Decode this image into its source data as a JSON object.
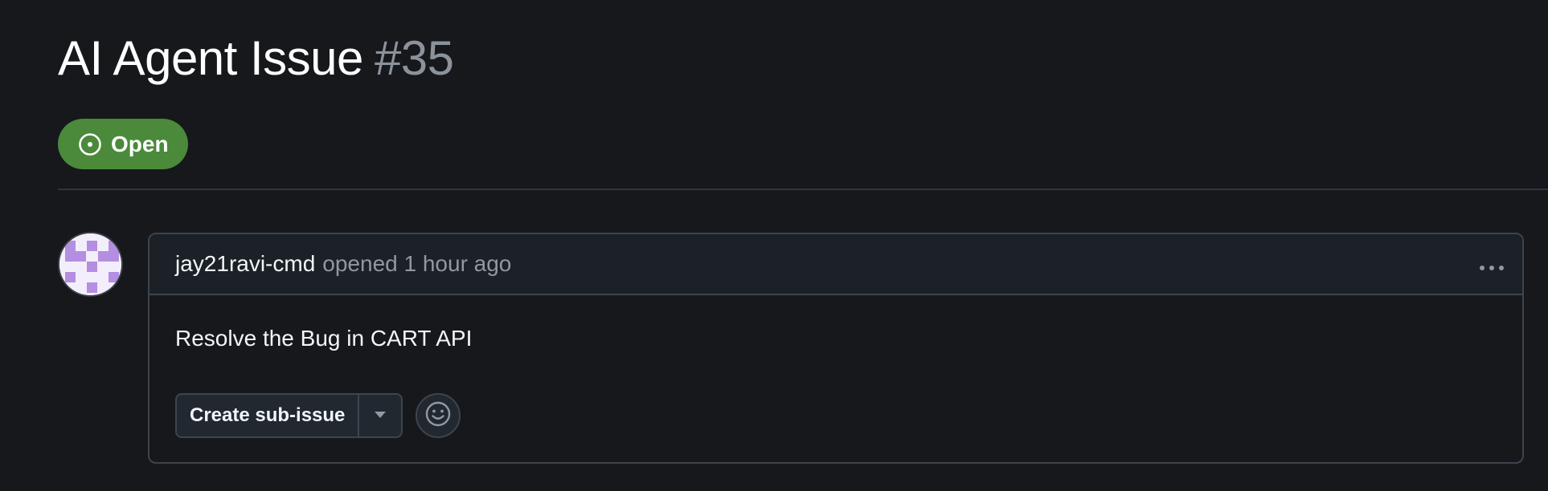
{
  "issue": {
    "title": "AI Agent Issue",
    "number": "#35",
    "state_label": "Open",
    "state_icon": "issue-opened-icon",
    "state_color": "#4a8a3a"
  },
  "comment": {
    "author": "jay21ravi-cmd",
    "meta": "opened 1 hour ago",
    "body": "Resolve the Bug in CART API",
    "menu_icon": "kebab-horizontal-icon"
  },
  "actions": {
    "create_sub_issue_label": "Create sub-issue",
    "dropdown_icon": "triangle-down-icon",
    "reaction_icon": "smiley-icon"
  },
  "colors": {
    "background": "#16181c",
    "header_bg": "#1c2027",
    "border": "#3d444d",
    "muted_text": "#9198a1",
    "avatar_purple": "#b48ee0"
  }
}
